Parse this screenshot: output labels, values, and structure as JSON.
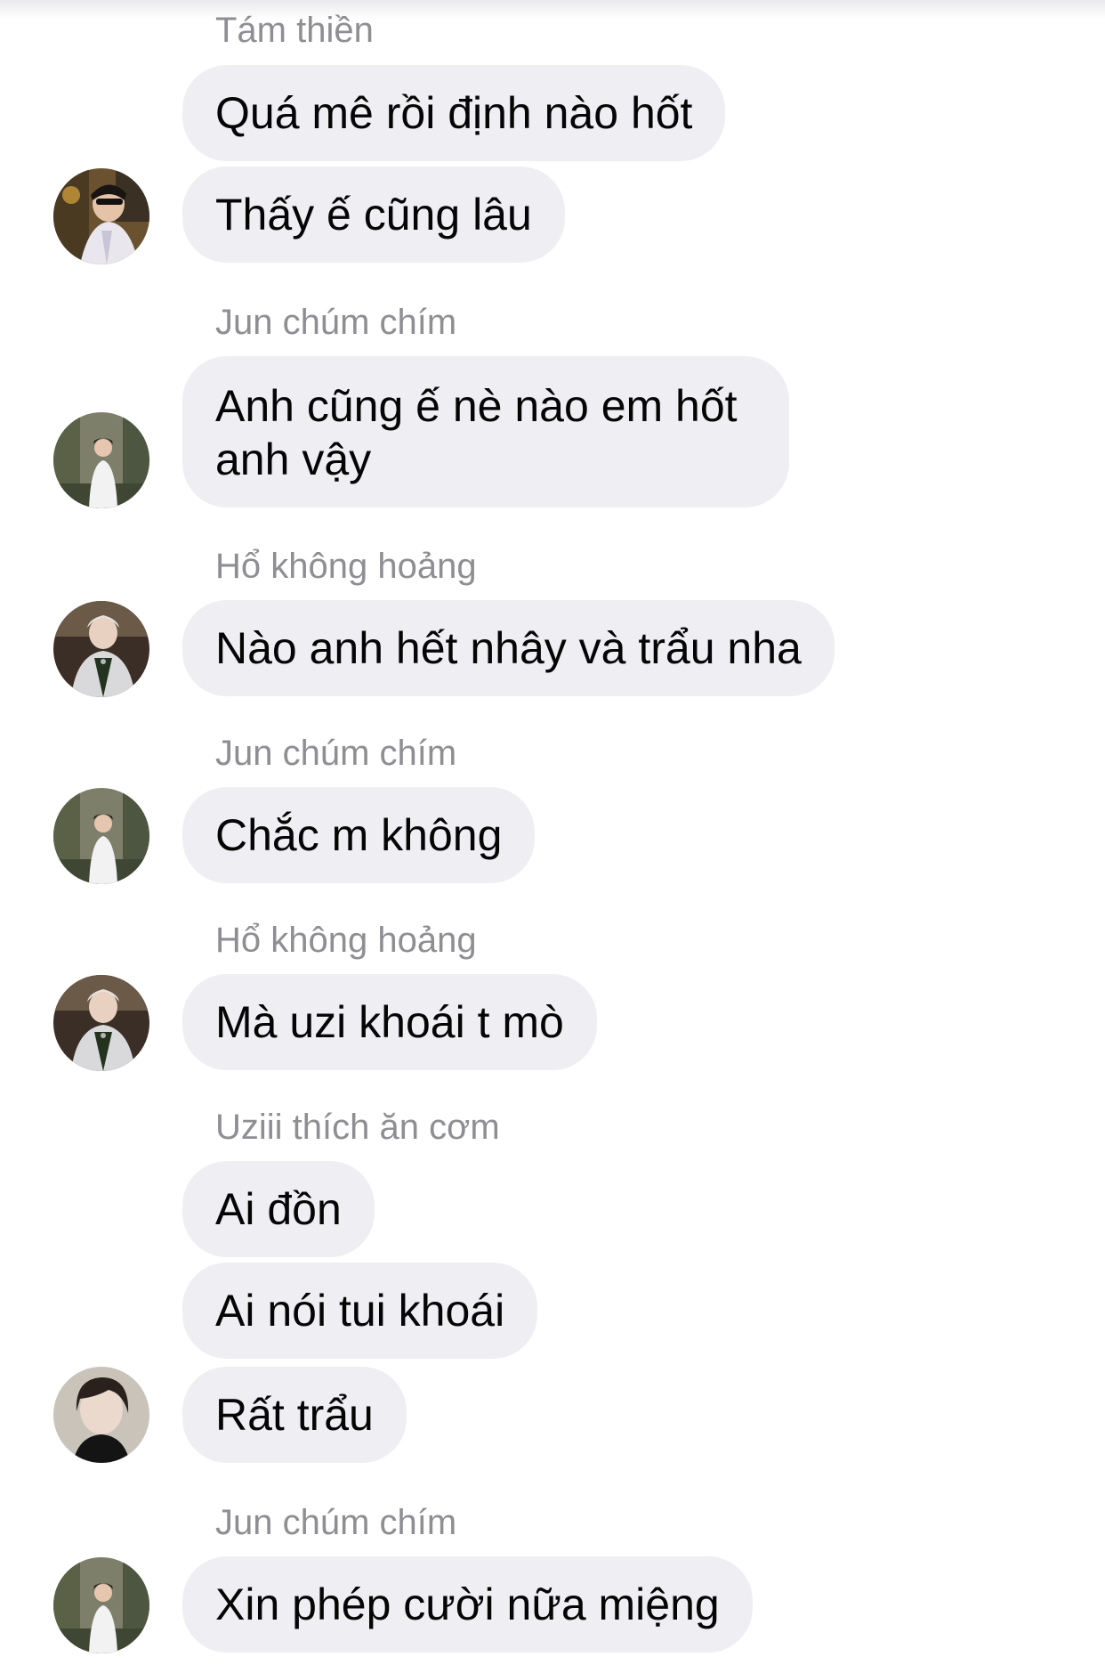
{
  "messages": [
    {
      "sender": "Tám thiền",
      "lines": [
        "Quá mê rồi định nào hốt",
        "Thấy ế cũng lâu"
      ],
      "avatar": "avatar-tam-thien-icon"
    },
    {
      "sender": "Jun chúm chím",
      "lines": [
        "Anh cũng ế nè nào em hốt anh vậy"
      ],
      "avatar": "avatar-jun-chum-chim-icon"
    },
    {
      "sender": "Hổ không hoảng",
      "lines": [
        "Nào anh hết nhây và trẩu nha"
      ],
      "avatar": "avatar-ho-khong-hoang-icon"
    },
    {
      "sender": "Jun chúm chím",
      "lines": [
        "Chắc m không"
      ],
      "avatar": "avatar-jun-chum-chim-icon"
    },
    {
      "sender": "Hổ không hoảng",
      "lines": [
        "Mà uzi khoái t mò"
      ],
      "avatar": "avatar-ho-khong-hoang-icon"
    },
    {
      "sender": "Uziii thích ăn cơm",
      "lines": [
        "Ai đồn",
        "Ai nói tui khoái",
        "Rất trẩu"
      ],
      "avatar": "avatar-uziii-icon"
    },
    {
      "sender": "Jun chúm chím",
      "lines": [
        "Xin phép cười nữa miệng"
      ],
      "avatar": "avatar-jun-chum-chim-icon"
    }
  ],
  "colors": {
    "bubble": "#efeff3",
    "sender_text": "#8e8e93",
    "message_text": "#050505"
  }
}
